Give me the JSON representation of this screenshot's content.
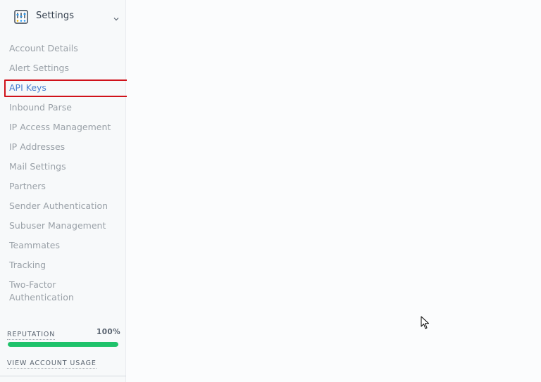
{
  "sidebar": {
    "header": {
      "title": "Settings",
      "icon": "settings-sliders-icon",
      "chevron": "chevron-down-icon"
    },
    "items": [
      {
        "label": "Account Details",
        "active": false
      },
      {
        "label": "Alert Settings",
        "active": false
      },
      {
        "label": "API Keys",
        "active": true
      },
      {
        "label": "Inbound Parse",
        "active": false
      },
      {
        "label": "IP Access Management",
        "active": false
      },
      {
        "label": "IP Addresses",
        "active": false
      },
      {
        "label": "Mail Settings",
        "active": false
      },
      {
        "label": "Partners",
        "active": false
      },
      {
        "label": "Sender Authentication",
        "active": false
      },
      {
        "label": "Subuser Management",
        "active": false
      },
      {
        "label": "Teammates",
        "active": false
      },
      {
        "label": "Tracking",
        "active": false
      },
      {
        "label": "Two-Factor Authentication",
        "active": false
      }
    ],
    "reputation": {
      "label": "REPUTATION",
      "value_text": "100%",
      "fraction": 1.0
    },
    "usage_link": "VIEW ACCOUNT USAGE"
  },
  "colors": {
    "accent": "#4a7fd0",
    "highlight": "#d0121a",
    "reputation_bar": "#1ec26a",
    "nav_text": "#9aa1a8"
  }
}
